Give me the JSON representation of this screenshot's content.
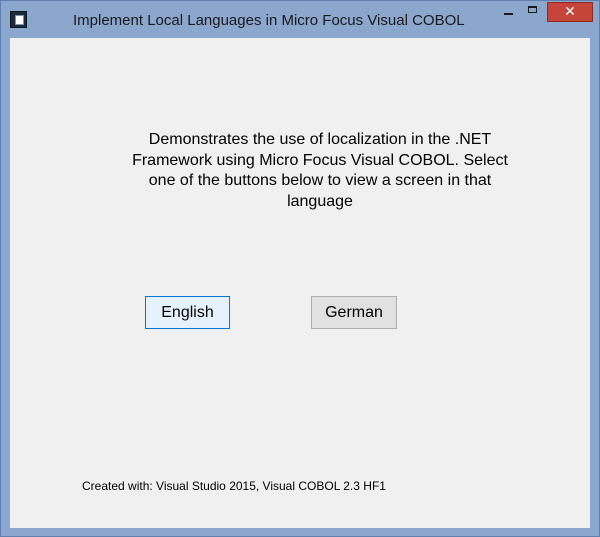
{
  "window": {
    "title": "Implement Local Languages in Micro Focus Visual COBOL",
    "controls": {
      "minimize_icon": "minimize-icon",
      "maximize_icon": "maximize-icon",
      "close_glyph": "✕"
    },
    "frame_color": "#8ba7ce",
    "close_color": "#c7443a"
  },
  "main": {
    "description": "Demonstrates the use of localization in the .NET Framework using Micro Focus Visual COBOL. Select one of the buttons below to view a screen in that language",
    "buttons": {
      "english_label": "English",
      "german_label": "German"
    },
    "footer": "Created with: Visual Studio 2015, Visual COBOL 2.3 HF1"
  }
}
